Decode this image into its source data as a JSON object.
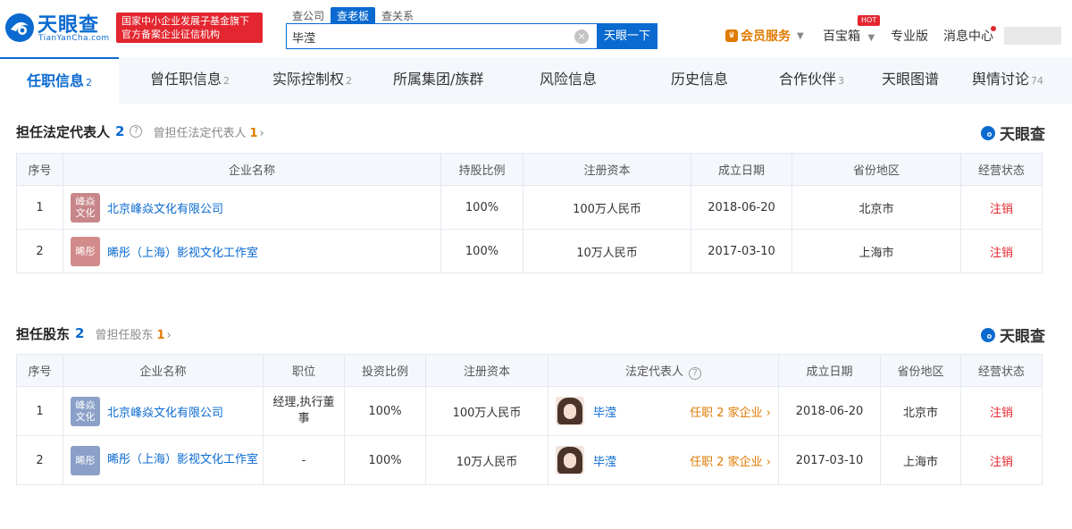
{
  "header": {
    "logo_text": "天眼查",
    "logo_sub": "TianYanCha.com",
    "gov_badge_line1": "国家中小企业发展子基金旗下",
    "gov_badge_line2": "官方备案企业征信机构",
    "search_tabs": [
      "查公司",
      "查老板",
      "查关系"
    ],
    "search_value": "毕滢",
    "search_button": "天眼一下",
    "vip_label": "会员服务",
    "treasure_label": "百宝箱",
    "hot_label": "HOT",
    "pro_label": "专业版",
    "message_label": "消息中心"
  },
  "main_tabs": [
    {
      "label": "任职信息",
      "count": "2"
    },
    {
      "label": "曾任职信息",
      "count": "2"
    },
    {
      "label": "实际控制权",
      "count": "2"
    },
    {
      "label": "所属集团/族群",
      "count": ""
    },
    {
      "label": "风险信息",
      "count": ""
    },
    {
      "label": "历史信息",
      "count": ""
    },
    {
      "label": "合作伙伴",
      "count": "3"
    },
    {
      "label": "天眼图谱",
      "count": ""
    },
    {
      "label": "舆情讨论",
      "count": "74"
    }
  ],
  "brand_watermark": "天眼查",
  "legal_rep": {
    "title": "担任法定代表人",
    "count": "2",
    "former_label": "曾担任法定代表人",
    "former_count": "1",
    "columns": [
      "序号",
      "企业名称",
      "持股比例",
      "注册资本",
      "成立日期",
      "省份地区",
      "经营状态"
    ],
    "rows": [
      {
        "no": "1",
        "logo": "峰焱\n文化",
        "logo_color": "#c8868a",
        "name": "北京峰焱文化有限公司",
        "share": "100%",
        "capital": "100万人民币",
        "date": "2018-06-20",
        "region": "北京市",
        "status": "注销"
      },
      {
        "no": "2",
        "logo": "晞彤",
        "logo_color": "#d28b8b",
        "name": "晞彤（上海）影视文化工作室",
        "share": "100%",
        "capital": "10万人民币",
        "date": "2017-03-10",
        "region": "上海市",
        "status": "注销"
      }
    ]
  },
  "shareholder": {
    "title": "担任股东",
    "count": "2",
    "former_label": "曾担任股东",
    "former_count": "1",
    "columns": [
      "序号",
      "企业名称",
      "职位",
      "投资比例",
      "注册资本",
      "法定代表人",
      "成立日期",
      "省份地区",
      "经营状态"
    ],
    "rows": [
      {
        "no": "1",
        "logo": "峰焱\n文化",
        "logo_color": "#8aa0c8",
        "name": "北京峰焱文化有限公司",
        "position": "经理,执行董事",
        "ratio": "100%",
        "capital": "100万人民币",
        "rep": "毕滢",
        "rep_post": "任职 2 家企业",
        "date": "2018-06-20",
        "region": "北京市",
        "status": "注销"
      },
      {
        "no": "2",
        "logo": "晞彤",
        "logo_color": "#8aa0c8",
        "name": "晞彤（上海）影视文化工作室",
        "position": "-",
        "ratio": "100%",
        "capital": "10万人民币",
        "rep": "毕滢",
        "rep_post": "任职 2 家企业",
        "date": "2017-03-10",
        "region": "上海市",
        "status": "注销"
      }
    ]
  }
}
